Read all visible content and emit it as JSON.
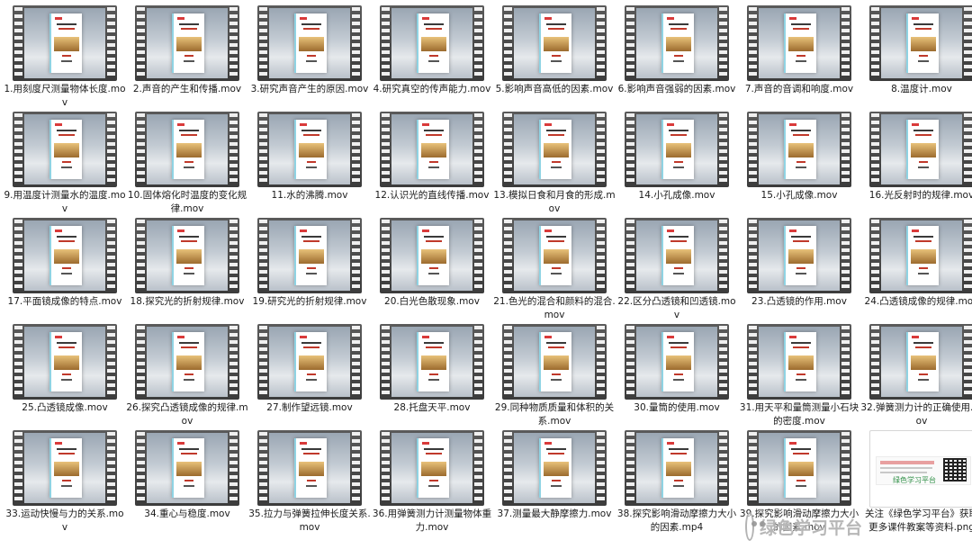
{
  "files": [
    {
      "name": "1.用刻度尺测量物体长度.mov",
      "type": "video"
    },
    {
      "name": "2.声音的产生和传播.mov",
      "type": "video"
    },
    {
      "name": "3.研究声音产生的原因.mov",
      "type": "video"
    },
    {
      "name": "4.研究真空的传声能力.mov",
      "type": "video"
    },
    {
      "name": "5.影响声音高低的因素.mov",
      "type": "video"
    },
    {
      "name": "6.影响声音强弱的因素.mov",
      "type": "video"
    },
    {
      "name": "7.声音的音调和响度.mov",
      "type": "video"
    },
    {
      "name": "8.温度计.mov",
      "type": "video"
    },
    {
      "name": "9.用温度计测量水的温度.mov",
      "type": "video"
    },
    {
      "name": "10.固体熔化时温度的变化规律.mov",
      "type": "video"
    },
    {
      "name": "11.水的沸腾.mov",
      "type": "video"
    },
    {
      "name": "12.认识光的直线传播.mov",
      "type": "video"
    },
    {
      "name": "13.模拟日食和月食的形成.mov",
      "type": "video"
    },
    {
      "name": "14.小孔成像.mov",
      "type": "video"
    },
    {
      "name": "15.小孔成像.mov",
      "type": "video"
    },
    {
      "name": "16.光反射时的规律.mov",
      "type": "video"
    },
    {
      "name": "17.平面镜成像的特点.mov",
      "type": "video"
    },
    {
      "name": "18.探究光的折射规律.mov",
      "type": "video"
    },
    {
      "name": "19.研究光的折射规律.mov",
      "type": "video"
    },
    {
      "name": "20.白光色散现象.mov",
      "type": "video"
    },
    {
      "name": "21.色光的混合和颜料的混合.mov",
      "type": "video"
    },
    {
      "name": "22.区分凸透镜和凹透镜.mov",
      "type": "video"
    },
    {
      "name": "23.凸透镜的作用.mov",
      "type": "video"
    },
    {
      "name": "24.凸透镜成像的规律.mov",
      "type": "video"
    },
    {
      "name": "25.凸透镜成像.mov",
      "type": "video"
    },
    {
      "name": "26.探究凸透镜成像的规律.mov",
      "type": "video"
    },
    {
      "name": "27.制作望远镜.mov",
      "type": "video"
    },
    {
      "name": "28.托盘天平.mov",
      "type": "video"
    },
    {
      "name": "29.同种物质质量和体积的关系.mov",
      "type": "video"
    },
    {
      "name": "30.量筒的使用.mov",
      "type": "video"
    },
    {
      "name": "31.用天平和量筒测量小石块的密度.mov",
      "type": "video"
    },
    {
      "name": "32.弹簧测力计的正确使用.mov",
      "type": "video"
    },
    {
      "name": "33.运动快慢与力的关系.mov",
      "type": "video"
    },
    {
      "name": "34.重心与稳度.mov",
      "type": "video"
    },
    {
      "name": "35.拉力与弹簧拉伸长度关系.mov",
      "type": "video"
    },
    {
      "name": "36.用弹簧测力计测量物体重力.mov",
      "type": "video"
    },
    {
      "name": "37.测量最大静摩擦力.mov",
      "type": "video"
    },
    {
      "name": "38.探究影响滑动摩擦力大小的因素.mp4",
      "type": "video"
    },
    {
      "name": "39.探究影响滑动摩擦力大小的因素.mov",
      "type": "video"
    },
    {
      "name": "关注《绿色学习平台》获取更多课件教案等资料.png",
      "type": "image"
    }
  ],
  "image_thumb_brand": "绿色学习平台",
  "watermark": {
    "text": "绿色学习平台",
    "icon": "wechat-icon"
  }
}
